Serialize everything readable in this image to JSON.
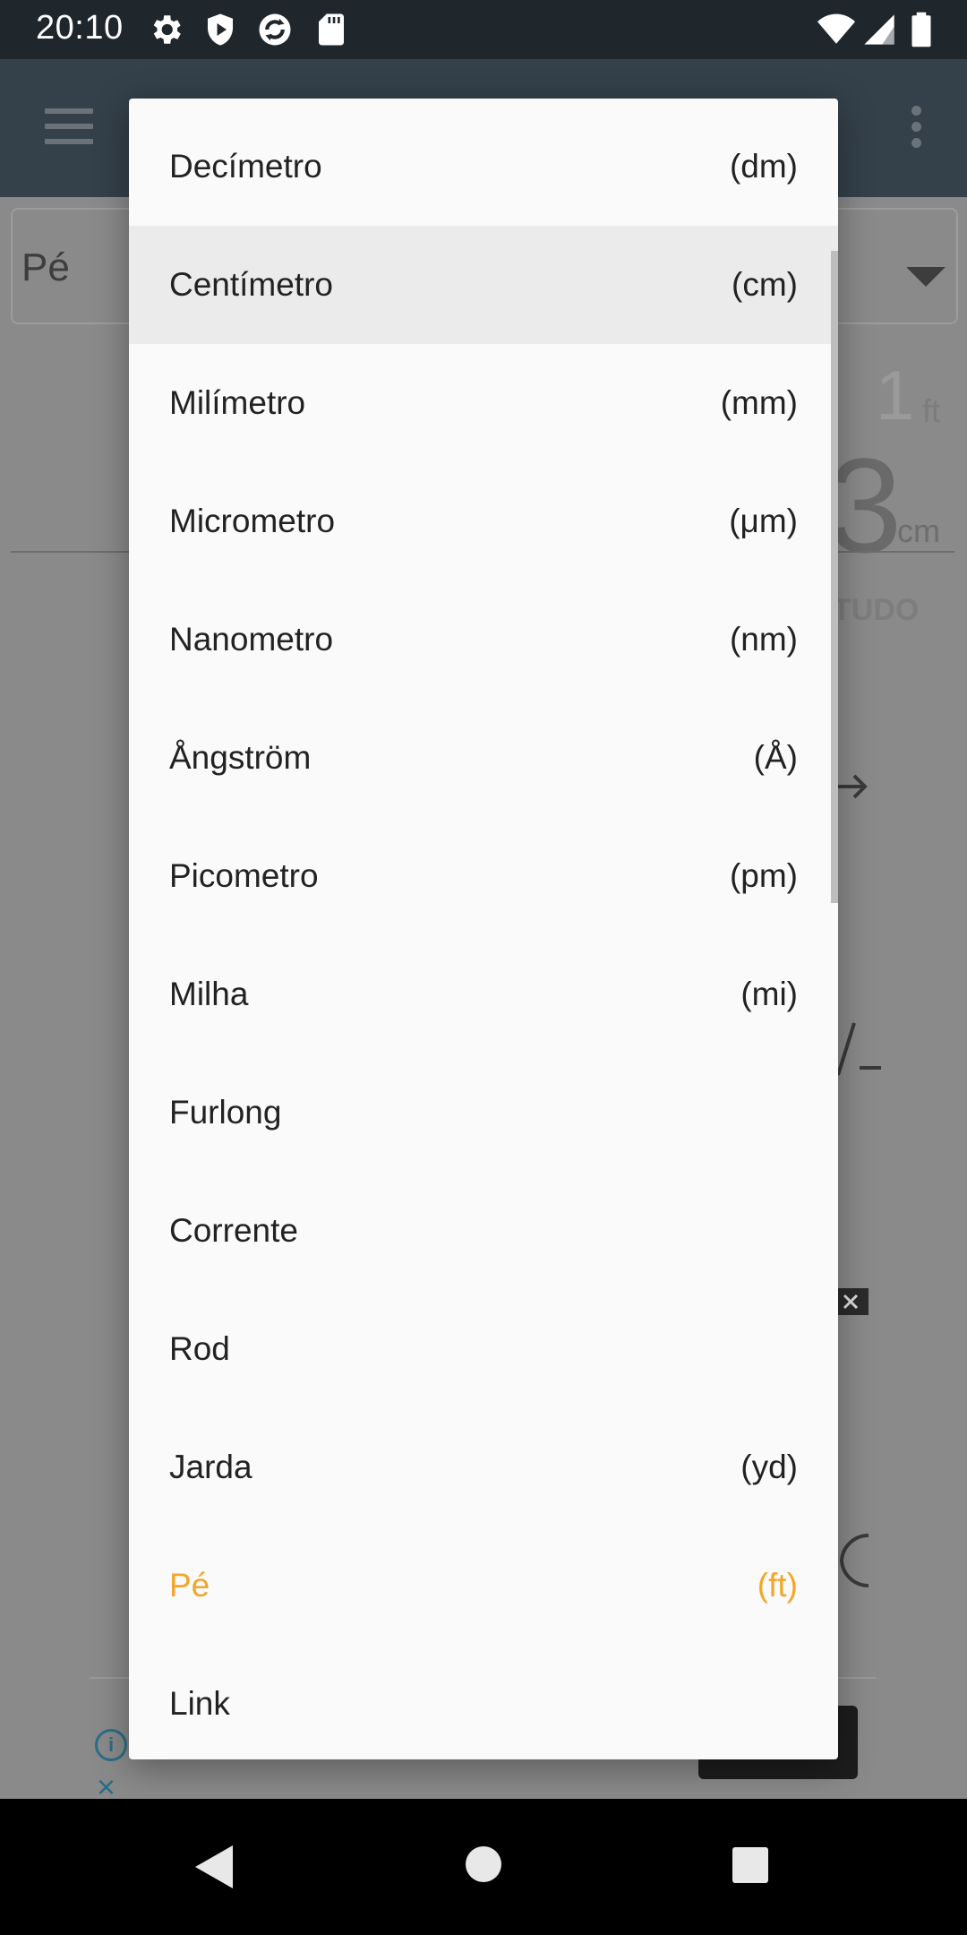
{
  "status_bar": {
    "time": "20:10",
    "icons": [
      "gear-icon",
      "shield-icon",
      "sync-icon",
      "sd-card-icon",
      "wifi-icon",
      "signal-icon",
      "battery-icon"
    ]
  },
  "background": {
    "selected_unit": "Pé",
    "value_top": "1",
    "unit_top": "ft",
    "value_bottom": "3",
    "unit_bottom": "cm",
    "clear_all": "TUDO"
  },
  "unit_list": {
    "highlight_color": "#f2a62b",
    "items": [
      {
        "label": "Decímetro",
        "abbr": "(dm)"
      },
      {
        "label": "Centímetro",
        "abbr": "(cm)"
      },
      {
        "label": "Milímetro",
        "abbr": "(mm)"
      },
      {
        "label": "Micrometro",
        "abbr": "(μm)"
      },
      {
        "label": "Nanometro",
        "abbr": "(nm)"
      },
      {
        "label": "Ångström",
        "abbr": "(Å)"
      },
      {
        "label": "Picometro",
        "abbr": "(pm)"
      },
      {
        "label": "Milha",
        "abbr": "(mi)"
      },
      {
        "label": "Furlong",
        "abbr": ""
      },
      {
        "label": "Corrente",
        "abbr": ""
      },
      {
        "label": "Rod",
        "abbr": ""
      },
      {
        "label": "Jarda",
        "abbr": "(yd)"
      },
      {
        "label": "Pé",
        "abbr": "(ft)"
      },
      {
        "label": "Link",
        "abbr": ""
      }
    ]
  }
}
